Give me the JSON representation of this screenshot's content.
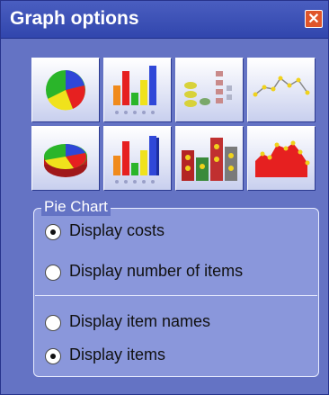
{
  "window": {
    "title": "Graph options",
    "close_glyph": "✕"
  },
  "graph_buttons": [
    {
      "icon": "pie-chart-2d-icon"
    },
    {
      "icon": "bar-chart-2d-icon"
    },
    {
      "icon": "pictogram-chart-2d-icon"
    },
    {
      "icon": "line-chart-icon"
    },
    {
      "icon": "pie-chart-3d-icon"
    },
    {
      "icon": "bar-chart-3d-icon"
    },
    {
      "icon": "pictogram-chart-3d-icon"
    },
    {
      "icon": "area-chart-icon"
    }
  ],
  "group": {
    "label": "Pie Chart",
    "options": [
      {
        "label": "Display costs",
        "selected": true
      },
      {
        "label": "Display number of items",
        "selected": false
      },
      {
        "label": "Display item names",
        "selected": false
      },
      {
        "label": "Display items",
        "selected": true
      }
    ]
  }
}
